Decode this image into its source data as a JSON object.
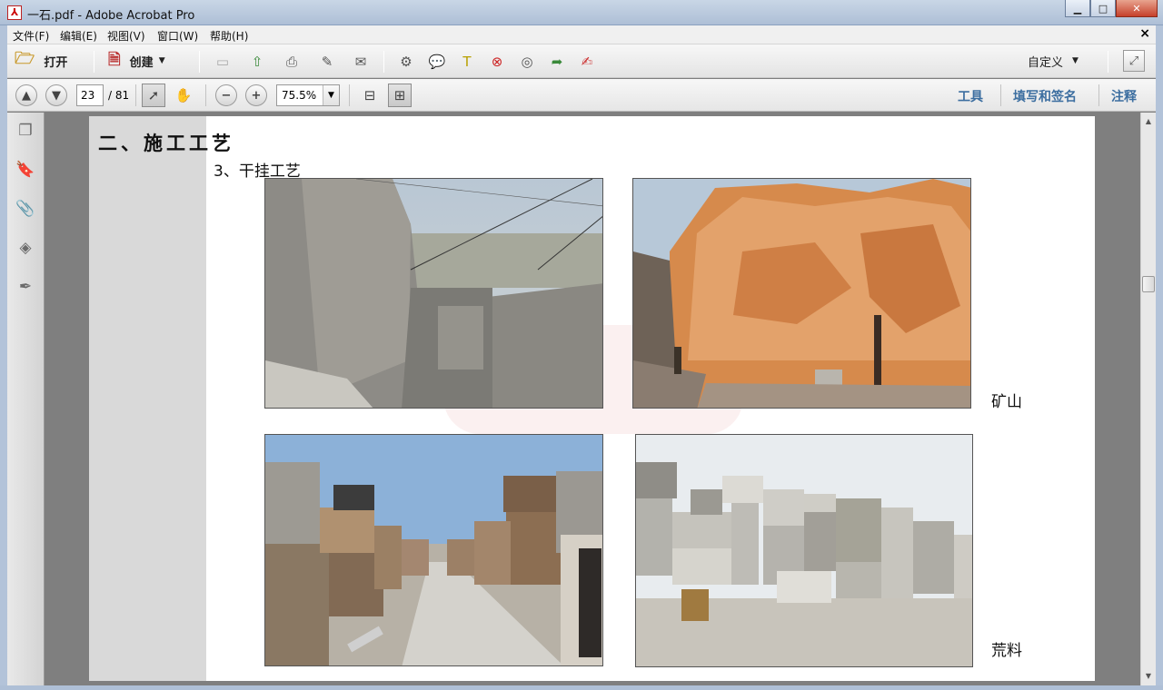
{
  "window": {
    "title": "一石.pdf - Adobe Acrobat Pro",
    "app_icon": "acrobat-pdf-icon",
    "controls": [
      "minimize",
      "maximize",
      "close"
    ]
  },
  "menubar": {
    "items": [
      "文件(F)",
      "编辑(E)",
      "视图(V)",
      "窗口(W)",
      "帮助(H)"
    ],
    "close_glyph": "×"
  },
  "toolbar1": {
    "open_label": "打开",
    "create_label": "创建",
    "customize_label": "自定义",
    "icons": [
      "save-icon",
      "upload-icon",
      "print-icon",
      "edit-icon",
      "email-icon",
      "settings-icon",
      "comment-icon",
      "highlight-icon",
      "delete-page-icon",
      "scan-icon",
      "export-icon",
      "sign-icon"
    ]
  },
  "toolbar2": {
    "current_page": "23",
    "total_pages": "/ 81",
    "zoom": "75.5%",
    "tools_label": "工具",
    "fill_sign_label": "填写和签名",
    "comment_label": "注释"
  },
  "navpane": {
    "icons": [
      "pages-icon",
      "bookmarks-icon",
      "attachments-icon",
      "layers-icon",
      "signatures-icon"
    ]
  },
  "document": {
    "section_title": "二、施工工艺",
    "subsection_title": "3、干挂工艺",
    "caption_mine": "矿山",
    "caption_blocks": "荒料"
  },
  "colors": {
    "panel_link": "#3c6ea0",
    "page_background": "#ffffff",
    "doc_background": "#7f7f7f"
  }
}
